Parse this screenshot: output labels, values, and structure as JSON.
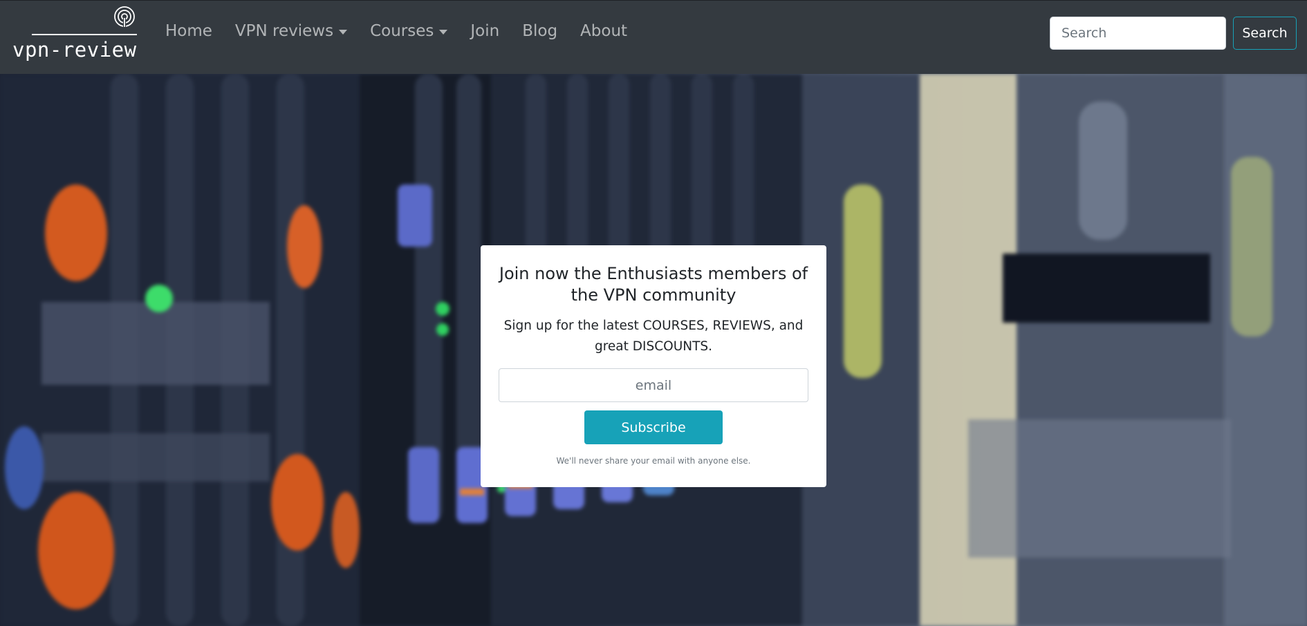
{
  "navbar": {
    "brand": {
      "text": "vpn-review",
      "icon": "broadcast-antenna-icon"
    },
    "links": [
      {
        "label": "Home",
        "dropdown": false
      },
      {
        "label": "VPN reviews",
        "dropdown": true
      },
      {
        "label": "Courses",
        "dropdown": true
      },
      {
        "label": "Join",
        "dropdown": false
      },
      {
        "label": "Blog",
        "dropdown": false
      },
      {
        "label": "About",
        "dropdown": false
      }
    ],
    "search": {
      "placeholder": "Search",
      "value": "",
      "button_label": "Search"
    }
  },
  "hero": {
    "background": "blurred-server-rack-photo",
    "signup_card": {
      "title": "Join now the Enthusiasts members of the VPN community",
      "text": "Sign up for the latest COURSES, REVIEWS, and great DISCOUNTS.",
      "email_placeholder": "email",
      "email_value": "",
      "button_label": "Subscribe",
      "disclaimer": "We'll never share your email with anyone else."
    }
  },
  "colors": {
    "navbar_bg": "#343a40",
    "accent": "#17a2b8",
    "card_bg": "#ffffff"
  }
}
